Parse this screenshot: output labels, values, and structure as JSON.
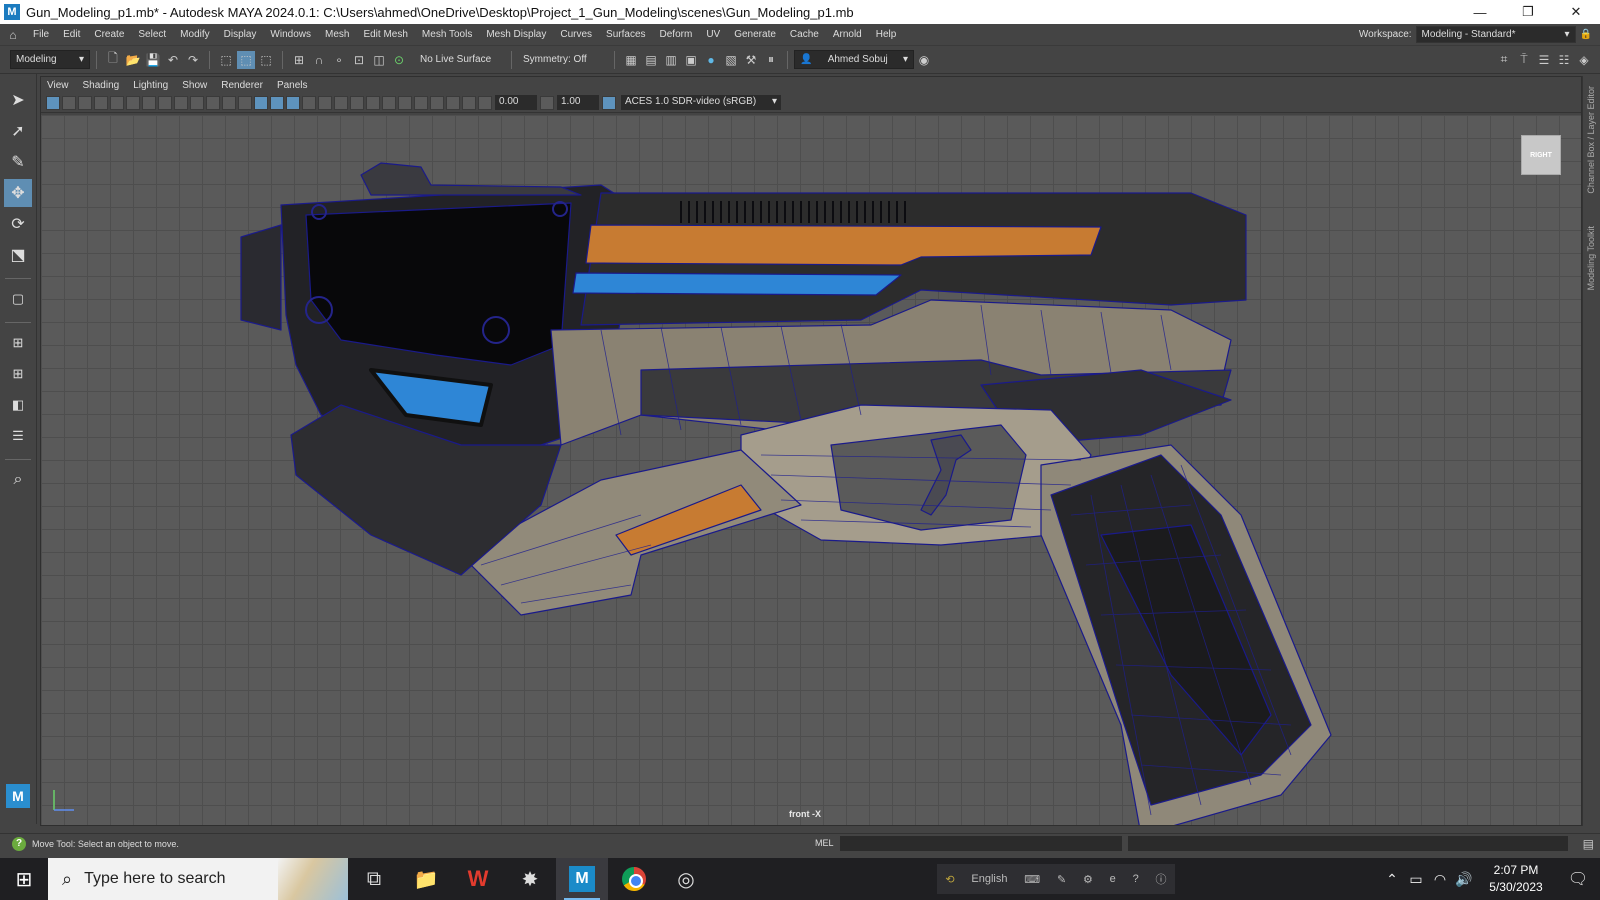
{
  "window": {
    "title": "Gun_Modeling_p1.mb* - Autodesk MAYA 2024.0.1: C:\\Users\\ahmed\\OneDrive\\Desktop\\Project_1_Gun_Modeling\\scenes\\Gun_Modeling_p1.mb",
    "minimize": "—",
    "restore": "❐",
    "close": "✕"
  },
  "menubar": {
    "items": [
      "File",
      "Edit",
      "Create",
      "Select",
      "Modify",
      "Display",
      "Windows",
      "Mesh",
      "Edit Mesh",
      "Mesh Tools",
      "Mesh Display",
      "Curves",
      "Surfaces",
      "Deform",
      "UV",
      "Generate",
      "Cache",
      "Arnold",
      "Help"
    ],
    "workspace_label": "Workspace:",
    "workspace_value": "Modeling - Standard*"
  },
  "shelf": {
    "menu_set": "Modeling",
    "live_surface": "No Live Surface",
    "symmetry": "Symmetry: Off",
    "user": "Ahmed Sobuj"
  },
  "panel": {
    "menus": [
      "View",
      "Shading",
      "Lighting",
      "Show",
      "Renderer",
      "Panels"
    ],
    "exposure": "0.00",
    "gamma": "1.00",
    "color_space": "ACES 1.0 SDR-video (sRGB)"
  },
  "viewport": {
    "view_cube_label": "RIGHT",
    "camera_label": "front -X",
    "colors": {
      "orange_stripe": "#c77b32",
      "blue_stripe": "#2e86d6",
      "wireframe": "#1a1a8a",
      "body_dark": "#2c2c2c",
      "body_light": "#8a8272"
    }
  },
  "right_dock": {
    "tab1": "Channel Box / Layer Editor",
    "tab2": "Modeling Toolkit"
  },
  "status": {
    "help_text": "Move Tool: Select an object to move.",
    "mel_label": "MEL"
  },
  "taskbar": {
    "search_placeholder": "Type here to search",
    "language": "English",
    "time": "2:07 PM",
    "date": "5/30/2023"
  }
}
